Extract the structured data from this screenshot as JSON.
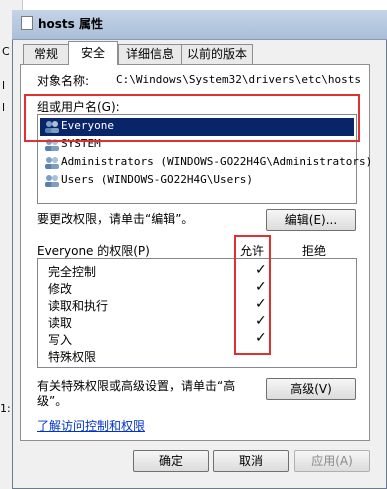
{
  "background": {
    "left_texts": [
      "C",
      "l",
      "l",
      "1:"
    ]
  },
  "dialog": {
    "title": "hosts 属性",
    "tabs": [
      {
        "label": "常规",
        "active": false
      },
      {
        "label": "安全",
        "active": true
      },
      {
        "label": "详细信息",
        "active": false
      },
      {
        "label": "以前的版本",
        "active": false
      }
    ],
    "object_label": "对象名称:",
    "object_path": "C:\\Windows\\System32\\drivers\\etc\\hosts",
    "group_label": "组或用户名(G):",
    "users": [
      {
        "name": "Everyone",
        "selected": true
      },
      {
        "name": "SYSTEM",
        "selected": false
      },
      {
        "name": "Administrators (WINDOWS-GO22H4G\\Administrators)",
        "selected": false
      },
      {
        "name": "Users (WINDOWS-GO22H4G\\Users)",
        "selected": false
      }
    ],
    "edit_hint": "要更改权限，请单击“编辑”。",
    "edit_button": "编辑(E)...",
    "perm_header": "Everyone 的权限(P)",
    "allow_header": "允许",
    "deny_header": "拒绝",
    "permissions": [
      {
        "name": "完全控制",
        "allow": "✓"
      },
      {
        "name": "修改",
        "allow": "✓"
      },
      {
        "name": "读取和执行",
        "allow": "✓"
      },
      {
        "name": "读取",
        "allow": "✓"
      },
      {
        "name": "写入",
        "allow": "✓"
      },
      {
        "name": "特殊权限",
        "allow": ""
      }
    ],
    "advanced_hint_line1": "有关特殊权限或高级设置，请单击“高",
    "advanced_hint_line2": "级”。",
    "advanced_button": "高级(V)",
    "access_link": "了解访问控制和权限",
    "ok_button": "确定",
    "cancel_button": "取消",
    "apply_button": "应用(A)",
    "highlight_color": "#e03030",
    "selection_color": "#0a246a"
  }
}
